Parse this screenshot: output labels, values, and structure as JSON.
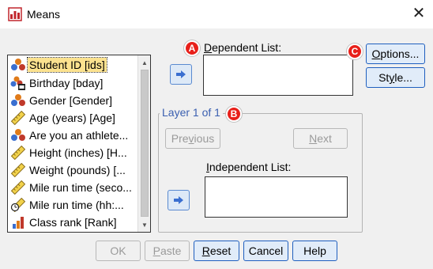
{
  "window": {
    "title": "Means",
    "close_glyph": "✕"
  },
  "variables": [
    {
      "label": "Student ID [ids]",
      "icon": "nominal-icon",
      "selected": true
    },
    {
      "label": "Birthday [bday]",
      "icon": "nominal-date-icon"
    },
    {
      "label": "Gender [Gender]",
      "icon": "nominal-icon"
    },
    {
      "label": "Age (years) [Age]",
      "icon": "scale-icon"
    },
    {
      "label": "Are you an athlete...",
      "icon": "nominal-icon"
    },
    {
      "label": "Height (inches) [H...",
      "icon": "scale-icon"
    },
    {
      "label": "Weight (pounds) [...",
      "icon": "scale-icon"
    },
    {
      "label": "Mile run time (seco...",
      "icon": "scale-icon"
    },
    {
      "label": "Mile run time (hh:...",
      "icon": "scale-time-icon"
    },
    {
      "label": "Class rank [Rank]",
      "icon": "ordinal-icon"
    }
  ],
  "dependent": {
    "label_prefix": "",
    "label_ul": "D",
    "label_rest": "ependent List:"
  },
  "layer": {
    "title": "Layer 1 of 1",
    "previous": {
      "pre": "Pre",
      "ul": "v",
      "post": "ious"
    },
    "next": {
      "pre": "",
      "ul": "N",
      "post": "ext"
    },
    "independent": {
      "pre": "",
      "ul": "I",
      "post": "ndependent List:"
    }
  },
  "side_buttons": {
    "options": {
      "pre": "",
      "ul": "O",
      "post": "ptions..."
    },
    "style": {
      "pre": "St",
      "ul": "y",
      "post": "le..."
    }
  },
  "bottom_buttons": {
    "ok": "OK",
    "paste": {
      "pre": "",
      "ul": "P",
      "post": "aste"
    },
    "reset": {
      "pre": "",
      "ul": "R",
      "post": "eset"
    },
    "cancel": "Cancel",
    "help": "Help"
  },
  "callouts": {
    "a": "A",
    "b": "B",
    "c": "C"
  },
  "colors": {
    "selection": "#fce28f",
    "callout": "#e8201a",
    "layer_title": "#3a5fb0",
    "arrow_button": "#3a6fd0"
  }
}
